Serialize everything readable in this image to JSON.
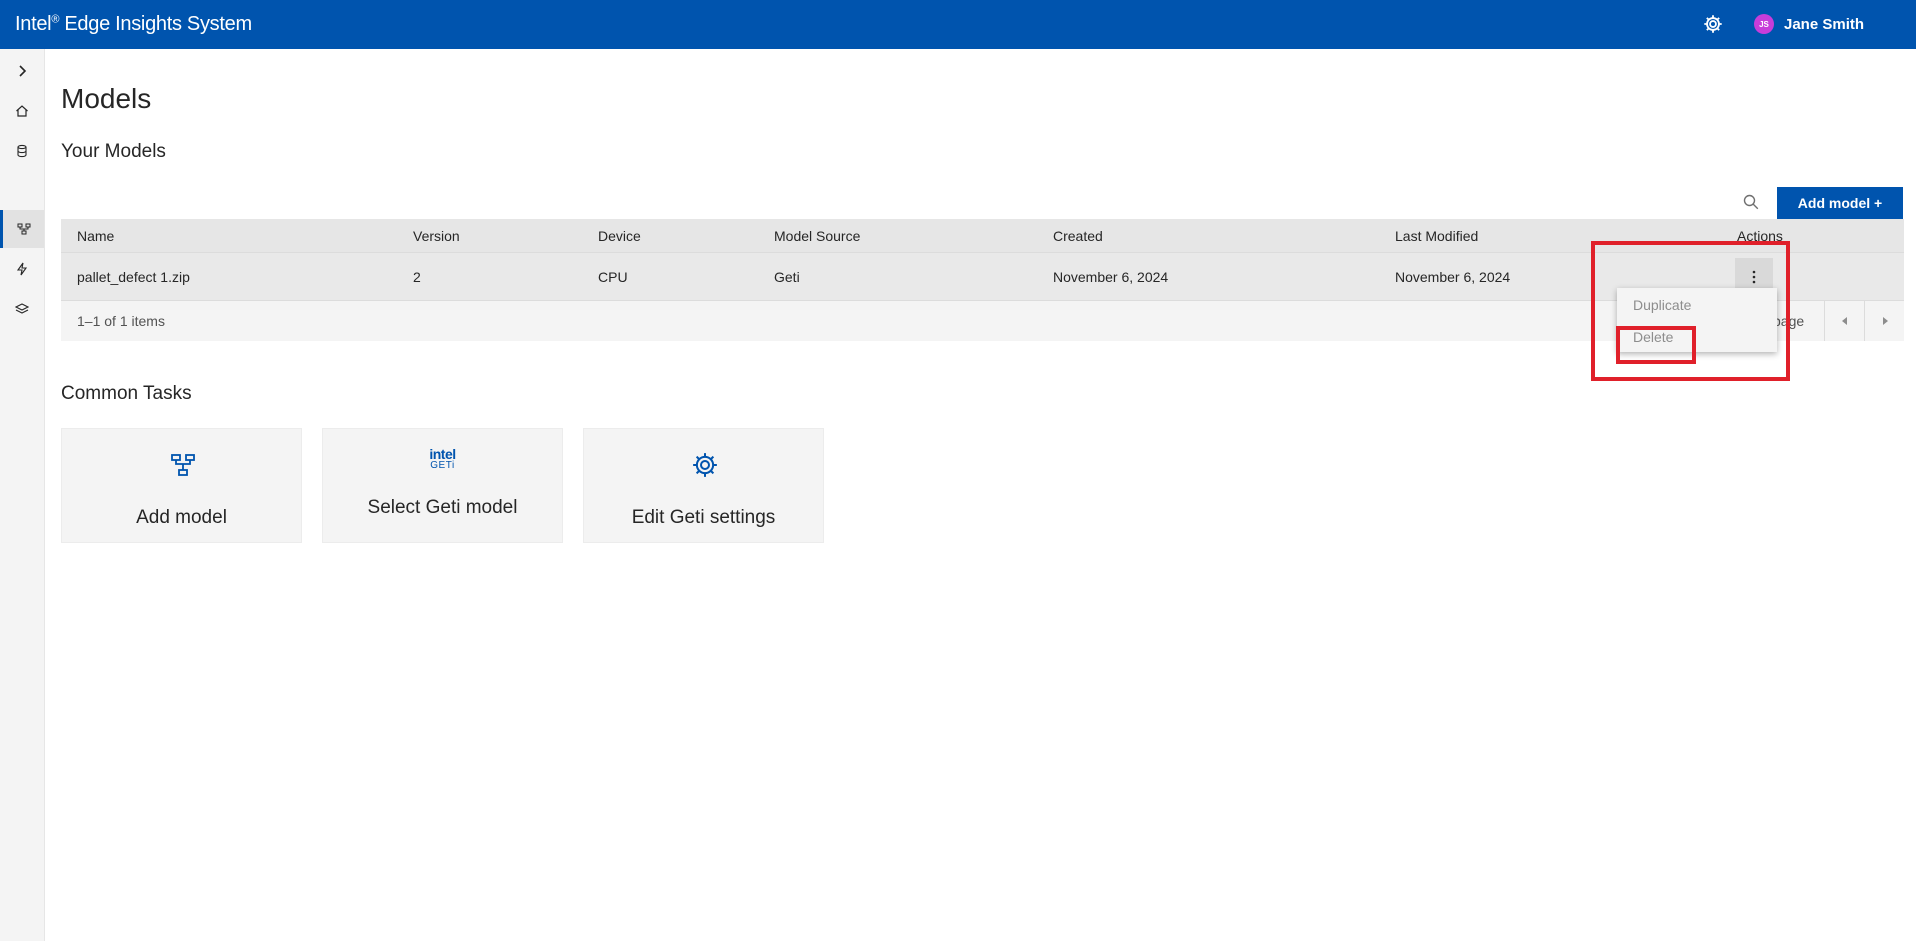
{
  "header": {
    "brand_prefix": "Intel",
    "brand_reg": "®",
    "brand_suffix": " Edge Insights System",
    "user_initials": "JS",
    "user_name": "Jane Smith"
  },
  "page": {
    "title": "Models",
    "subtitle": "Your Models",
    "add_model_label": "Add model +"
  },
  "table": {
    "columns": [
      "Name",
      "Version",
      "Device",
      "Model Source",
      "Created",
      "Last Modified",
      "Actions"
    ],
    "rows": [
      {
        "name": "pallet_defect 1.zip",
        "version": "2",
        "device": "CPU",
        "source": "Geti",
        "created": "November 6, 2024",
        "modified": "November 6, 2024"
      }
    ],
    "footer_count": "1–1 of 1 items",
    "footer_page": "page"
  },
  "actions_menu": {
    "items": [
      "Duplicate",
      "Delete"
    ]
  },
  "common_tasks": {
    "title": "Common Tasks",
    "cards": [
      {
        "label": "Add model"
      },
      {
        "label": "Select Geti model",
        "logo_line1": "intel",
        "logo_line2": "GETi"
      },
      {
        "label": "Edit Geti settings"
      }
    ]
  },
  "colors": {
    "brand_blue": "#0054ae",
    "highlight_red": "#e0202a",
    "avatar_purple": "#c73dd9"
  }
}
